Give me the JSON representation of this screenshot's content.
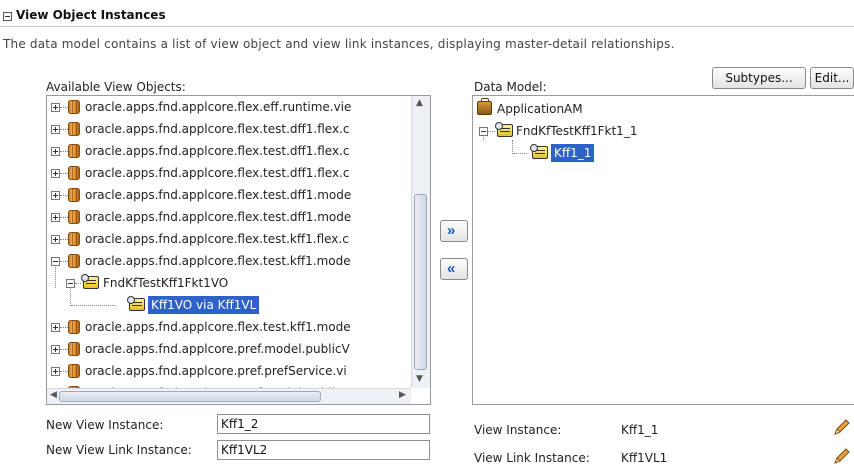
{
  "section": {
    "title": "View Object Instances",
    "description": "The data model contains a list of view object and view link instances, displaying master-detail relationships."
  },
  "available": {
    "label": "Available View Objects:",
    "items": [
      {
        "label": "oracle.apps.fnd.applcore.flex.eff.runtime.vie",
        "icon": "package-icon",
        "expanded": false
      },
      {
        "label": "oracle.apps.fnd.applcore.flex.test.dff1.flex.c",
        "icon": "package-icon",
        "expanded": false
      },
      {
        "label": "oracle.apps.fnd.applcore.flex.test.dff1.flex.c",
        "icon": "package-icon",
        "expanded": false
      },
      {
        "label": "oracle.apps.fnd.applcore.flex.test.dff1.flex.c",
        "icon": "package-icon",
        "expanded": false
      },
      {
        "label": "oracle.apps.fnd.applcore.flex.test.dff1.mode",
        "icon": "package-icon",
        "expanded": false
      },
      {
        "label": "oracle.apps.fnd.applcore.flex.test.dff1.mode",
        "icon": "package-icon",
        "expanded": false
      },
      {
        "label": "oracle.apps.fnd.applcore.flex.test.kff1.flex.c",
        "icon": "package-icon",
        "expanded": false
      },
      {
        "label": "oracle.apps.fnd.applcore.flex.test.kff1.mode",
        "icon": "package-icon",
        "expanded": true
      },
      {
        "label": "FndKfTestKff1Fkt1VO",
        "icon": "view-object-icon",
        "expanded": true
      },
      {
        "label": "Kff1VO via Kff1VL",
        "icon": "view-object-icon",
        "selected": true
      },
      {
        "label": "oracle.apps.fnd.applcore.flex.test.kff1.mode",
        "icon": "package-icon",
        "expanded": false
      },
      {
        "label": "oracle.apps.fnd.applcore.pref.model.publicV",
        "icon": "package-icon",
        "expanded": false
      },
      {
        "label": "oracle.apps.fnd.applcore.pref.prefService.vi",
        "icon": "package-icon",
        "expanded": false
      },
      {
        "label": "oracle.apps.fnd.applcore.pref.model.publicV",
        "icon": "package-icon",
        "expanded": false
      }
    ]
  },
  "data_model": {
    "label": "Data Model:",
    "subtypes_label": "Subtypes...",
    "edit_label": "Edit...",
    "items": [
      {
        "label": "ApplicationAM",
        "icon": "application-module-icon"
      },
      {
        "label": "FndKfTestKff1Fkt1_1",
        "icon": "view-object-icon",
        "expanded": true
      },
      {
        "label": "Kff1_1",
        "icon": "view-object-icon",
        "selected": true
      }
    ]
  },
  "shuttle": {
    "add_glyph": "»",
    "remove_glyph": "«"
  },
  "form": {
    "new_view_instance_label": "New View Instance:",
    "new_view_instance_value": "Kff1_2",
    "new_view_link_instance_label": "New View Link Instance:",
    "new_view_link_instance_value": "Kff1VL2",
    "view_instance_label": "View Instance:",
    "view_instance_value": "Kff1_1",
    "view_link_instance_label": "View Link Instance:",
    "view_link_instance_value": "Kff1VL1"
  },
  "colors": {
    "selection": "#2f62c9",
    "shuttle_arrow": "#1a56c7"
  }
}
